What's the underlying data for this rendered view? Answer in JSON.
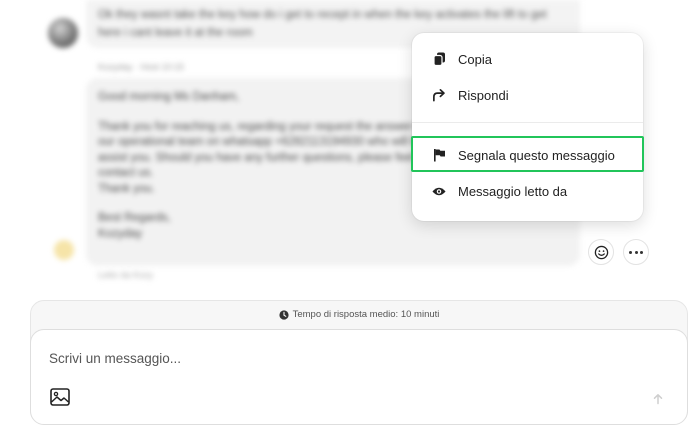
{
  "chat": {
    "guest_message": "Ok they wasnt take the key how do i get to recept in when the key activates the lift to get here i cant leave it at the room",
    "host_meta": "Kozyday · Host 10:15",
    "host_message": {
      "greeting": "Good morning Ms Danham,",
      "body_lines": [
        "Thank you for reaching us, regarding your request the answer [adjust]y",
        "our operational team on whatsapp +6282113194930 who will be happy to",
        "assist you. Should you have any further questions, please feel free to",
        "contact us.",
        "Thank you."
      ],
      "signoff_lines": [
        "Best Regards,",
        "Kozyday"
      ]
    },
    "bottom_meta": "Letto da Kozy"
  },
  "actions": {
    "emoji_icon": "smiley-icon",
    "more_icon": "ellipsis-icon"
  },
  "context_menu": {
    "items": [
      {
        "label": "Copia",
        "icon": "copy-icon"
      },
      {
        "label": "Rispondi",
        "icon": "reply-arrow-icon"
      },
      {
        "label": "Segnala questo messaggio",
        "icon": "flag-icon"
      },
      {
        "label": "Messaggio letto da",
        "icon": "eye-icon"
      }
    ],
    "highlight_color": "#21c55a"
  },
  "composer": {
    "response_time": "Tempo di risposta medio: 10 minuti",
    "placeholder": "Scrivi un messaggio...",
    "image_icon": "image-icon",
    "send_icon": "arrow-up-icon"
  }
}
